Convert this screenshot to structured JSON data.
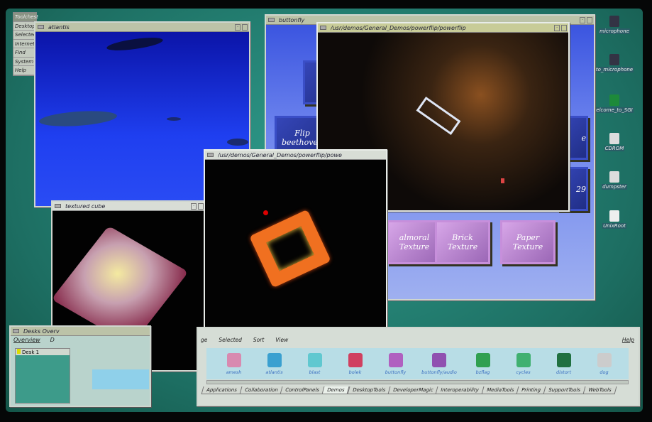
{
  "toolchest": {
    "title": "Toolchest",
    "items": [
      "Desktop",
      "Selected",
      "Internet",
      "Find",
      "System",
      "Help"
    ]
  },
  "windows": {
    "atlantis": {
      "title": "atlantis"
    },
    "buttonfly": {
      "title": "buttonfly",
      "buttons": [
        "Flip beethoven",
        "almoral Texture",
        "Brick Texture",
        "Paper Texture",
        "e",
        "29"
      ]
    },
    "powerflip1": {
      "title": "/usr/demos/General_Demos/powerflip/powerflip"
    },
    "powerflip2": {
      "title": "/usr/demos/General_Demos/powerflip/powe"
    },
    "cube": {
      "title": "textured cube"
    },
    "desks": {
      "title": "Desks Overv",
      "menu": [
        "Overview",
        "D"
      ],
      "desk1": "Desk 1"
    }
  },
  "catalog": {
    "menu": [
      "ge",
      "Selected",
      "Sort",
      "View"
    ],
    "help": "Help",
    "icons": [
      "amesh",
      "atlantis",
      "blast",
      "bolek",
      "buttonfly",
      "buttonfly/audio",
      "bzflag",
      "cycles",
      "distort",
      "dog"
    ],
    "tabs": [
      "Applications",
      "Collaboration",
      "ControlPanels",
      "Demos",
      "DesktopTools",
      "DeveloperMagic",
      "Interoperability",
      "MediaTools",
      "Printing",
      "SupportTools",
      "WebTools"
    ],
    "selected_tab": "Demos"
  },
  "desktop_icons": [
    "microphone",
    "to_microphone",
    "elcome_to_SGI",
    "CDROM",
    "dumpster",
    "UnixRoot"
  ]
}
